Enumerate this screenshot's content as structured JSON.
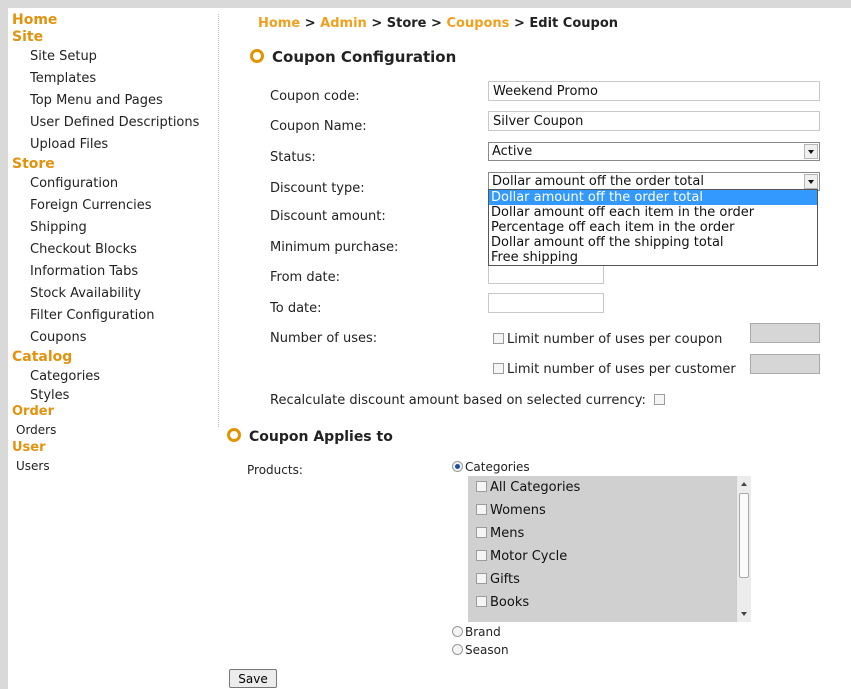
{
  "sidebar": {
    "home": "Home",
    "site": {
      "title": "Site",
      "items": [
        "Site Setup",
        "Templates",
        "Top Menu and Pages",
        "User Defined Descriptions",
        "Upload Files"
      ]
    },
    "store": {
      "title": "Store",
      "items": [
        "Configuration",
        "Foreign Currencies",
        "Shipping",
        "Checkout Blocks",
        "Information Tabs",
        "Stock Availability",
        "Filter Configuration",
        "Coupons"
      ]
    },
    "catalog": {
      "title": "Catalog",
      "items": [
        "Categories",
        "Styles"
      ]
    },
    "order": {
      "title": "Order",
      "items": [
        "Orders"
      ]
    },
    "user": {
      "title": "User",
      "items": [
        "Users"
      ]
    }
  },
  "breadcrumb": {
    "home": "Home",
    "sep": ">",
    "admin": "Admin",
    "store": "Store",
    "coupons": "Coupons",
    "current": "Edit Coupon"
  },
  "config": {
    "heading": "Coupon Configuration",
    "coupon_code_label": "Coupon code:",
    "coupon_code_value": "Weekend Promo",
    "coupon_name_label": "Coupon Name:",
    "coupon_name_value": "Silver Coupon",
    "status_label": "Status:",
    "status_value": "Active",
    "discount_type_label": "Discount type:",
    "discount_type_value": "Dollar amount off the order total",
    "discount_type_options": [
      "Dollar amount off the order total",
      "Dollar amount off each item in the order",
      "Percentage off each item in the order",
      "Dollar amount off the shipping total",
      "Free shipping"
    ],
    "discount_amount_label": "Discount amount:",
    "minimum_purchase_label": "Minimum purchase:",
    "from_date_label": "From date:",
    "to_date_label": "To date:",
    "number_of_uses_label": "Number of uses:",
    "limit_coupon_label": "Limit number of uses per coupon",
    "limit_customer_label": "Limit number of uses per customer",
    "recalculate_label": "Recalculate discount amount based on selected currency:"
  },
  "applies": {
    "heading": "Coupon Applies to",
    "products_label": "Products:",
    "categories_radio": "Categories",
    "categories_list": [
      "All Categories",
      "Womens",
      "Mens",
      "Motor Cycle",
      "Gifts",
      "Books"
    ],
    "brand_radio": "Brand",
    "season_radio": "Season"
  },
  "save_label": "Save"
}
